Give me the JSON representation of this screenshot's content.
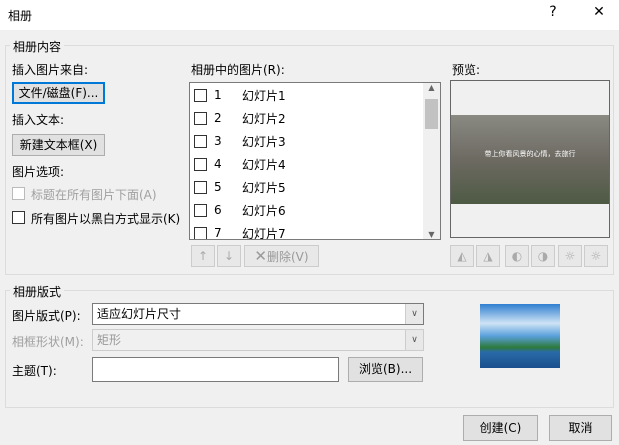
{
  "window": {
    "title": "相册",
    "help": "?",
    "close": "✕"
  },
  "content_group": {
    "label": "相册内容",
    "insert_from_label": "插入图片来自:",
    "file_button": "文件/磁盘(F)...",
    "insert_text_label": "插入文本:",
    "new_textbox_button": "新建文本框(X)",
    "picture_options_label": "图片选项:",
    "caption_option": "标题在所有图片下面(A)",
    "bw_option": "所有图片以黑白方式显示(K)",
    "list_label": "相册中的图片(R):",
    "items": [
      {
        "n": "1",
        "label": "幻灯片1"
      },
      {
        "n": "2",
        "label": "幻灯片2"
      },
      {
        "n": "3",
        "label": "幻灯片3"
      },
      {
        "n": "4",
        "label": "幻灯片4"
      },
      {
        "n": "5",
        "label": "幻灯片5"
      },
      {
        "n": "6",
        "label": "幻灯片6"
      },
      {
        "n": "7",
        "label": "幻灯片7"
      }
    ],
    "delete_button": "删除(V)",
    "preview_label": "预览:",
    "preview_caption": "带上你看风景的心情，去旅行"
  },
  "layout_group": {
    "label": "相册版式",
    "picture_layout_label": "图片版式(P):",
    "picture_layout_value": "适应幻灯片尺寸",
    "frame_shape_label": "相框形状(M):",
    "frame_shape_value": "矩形",
    "theme_label": "主题(T):",
    "theme_value": "",
    "browse_button": "浏览(B)..."
  },
  "footer": {
    "create_button": "创建(C)",
    "cancel_button": "取消"
  }
}
